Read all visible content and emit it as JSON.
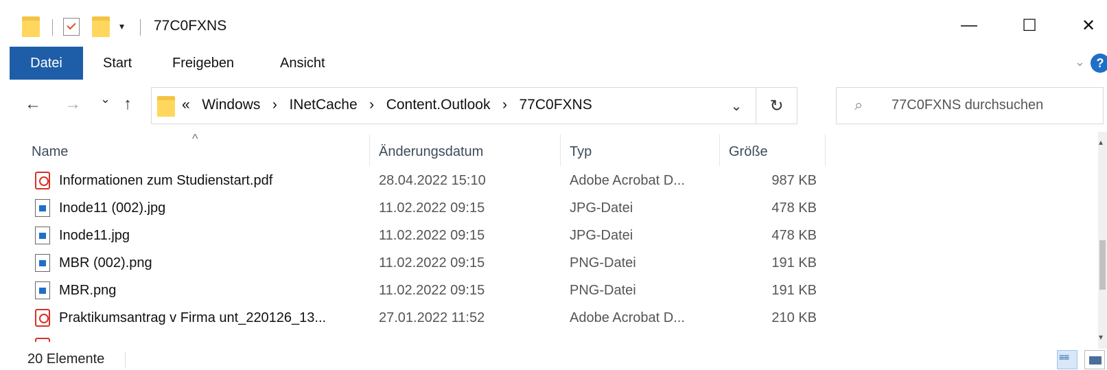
{
  "window": {
    "title": "77C0FXNS",
    "minimize": "—",
    "maximize": "☐",
    "close": "✕"
  },
  "ribbon": {
    "tabs": [
      "Datei",
      "Start",
      "Freigeben",
      "Ansicht"
    ],
    "active_tab": "Datei",
    "help": "?"
  },
  "nav": {
    "back": "←",
    "forward": "→",
    "recent": "⌄",
    "up": "↑"
  },
  "address": {
    "overflow": "«",
    "separator": "›",
    "crumbs": [
      "Windows",
      "INetCache",
      "Content.Outlook",
      "77C0FXNS"
    ],
    "dropdown": "⌄",
    "refresh": "↻"
  },
  "search": {
    "placeholder": "77C0FXNS durchsuchen",
    "icon": "search-icon"
  },
  "columns": {
    "name": "Name",
    "date": "Änderungsdatum",
    "type": "Typ",
    "size": "Größe"
  },
  "files": [
    {
      "name": "Informationen zum Studienstart.pdf",
      "date": "28.04.2022 15:10",
      "type": "Adobe Acrobat D...",
      "size": "987 KB",
      "icon": "pdf-icon"
    },
    {
      "name": "Inode11 (002).jpg",
      "date": "11.02.2022 09:15",
      "type": "JPG-Datei",
      "size": "478 KB",
      "icon": "image-icon"
    },
    {
      "name": "Inode11.jpg",
      "date": "11.02.2022 09:15",
      "type": "JPG-Datei",
      "size": "478 KB",
      "icon": "image-icon"
    },
    {
      "name": "MBR (002).png",
      "date": "11.02.2022 09:15",
      "type": "PNG-Datei",
      "size": "191 KB",
      "icon": "image-icon"
    },
    {
      "name": "MBR.png",
      "date": "11.02.2022 09:15",
      "type": "PNG-Datei",
      "size": "191 KB",
      "icon": "image-icon"
    },
    {
      "name": "Praktikumsantrag v Firma unt_220126_13...",
      "date": "27.01.2022 11:52",
      "type": "Adobe Acrobat D...",
      "size": "210 KB",
      "icon": "pdf-icon"
    }
  ],
  "status": {
    "count": "20 Elemente"
  },
  "colors": {
    "accent": "#1e5ea8",
    "folder": "#ffd75e",
    "pdf": "#d93025"
  }
}
